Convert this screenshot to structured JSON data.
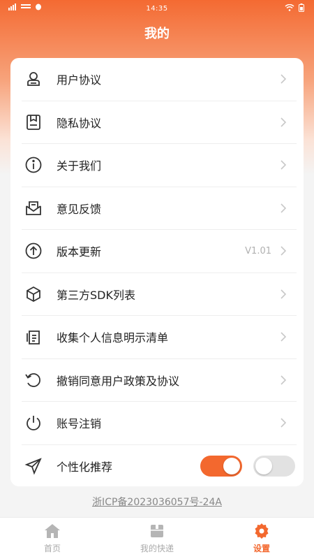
{
  "status": {
    "time": "14:35"
  },
  "header": {
    "title": "我的"
  },
  "menu": [
    {
      "label": "用户协议",
      "icon": "user-icon"
    },
    {
      "label": "隐私协议",
      "icon": "document-icon"
    },
    {
      "label": "关于我们",
      "icon": "info-icon"
    },
    {
      "label": "意见反馈",
      "icon": "feedback-mail-icon"
    },
    {
      "label": "版本更新",
      "icon": "arrow-up-circle-icon",
      "value": "V1.01"
    },
    {
      "label": "第三方SDK列表",
      "icon": "cube-icon"
    },
    {
      "label": "收集个人信息明示清单",
      "icon": "list-doc-icon"
    },
    {
      "label": "撤销同意用户政策及协议",
      "icon": "undo-icon"
    },
    {
      "label": "账号注销",
      "icon": "power-icon"
    }
  ],
  "personalization": {
    "label": "个性化推荐",
    "icon": "send-icon",
    "toggle_on": true,
    "toggle_off": false
  },
  "footer": {
    "icp": "浙ICP备2023036057号-24A"
  },
  "tabs": [
    {
      "label": "首页",
      "icon": "home-icon",
      "active": false
    },
    {
      "label": "我的快递",
      "icon": "package-icon",
      "active": false
    },
    {
      "label": "设置",
      "icon": "gear-icon",
      "active": true
    }
  ],
  "colors": {
    "accent": "#f3682e",
    "icon": "#333333",
    "chevron": "#c8c8c8"
  }
}
